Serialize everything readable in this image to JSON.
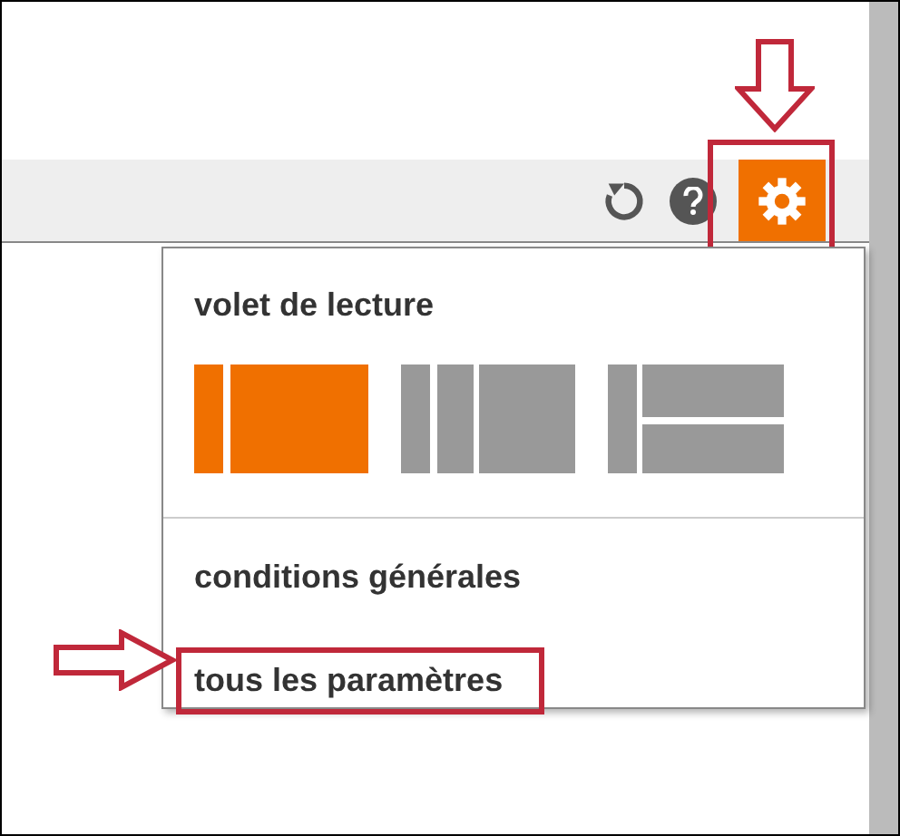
{
  "toolbar": {
    "settings_button": {
      "active": true,
      "annotated": true
    }
  },
  "settings_menu": {
    "title": "volet de lecture",
    "layouts": [
      {
        "kind": "right",
        "selected": true
      },
      {
        "kind": "columns",
        "selected": false
      },
      {
        "kind": "bottom",
        "selected": false
      }
    ],
    "items": [
      {
        "label": "conditions générales",
        "annotated": false
      },
      {
        "label": "tous les paramètres",
        "annotated": true
      }
    ]
  }
}
